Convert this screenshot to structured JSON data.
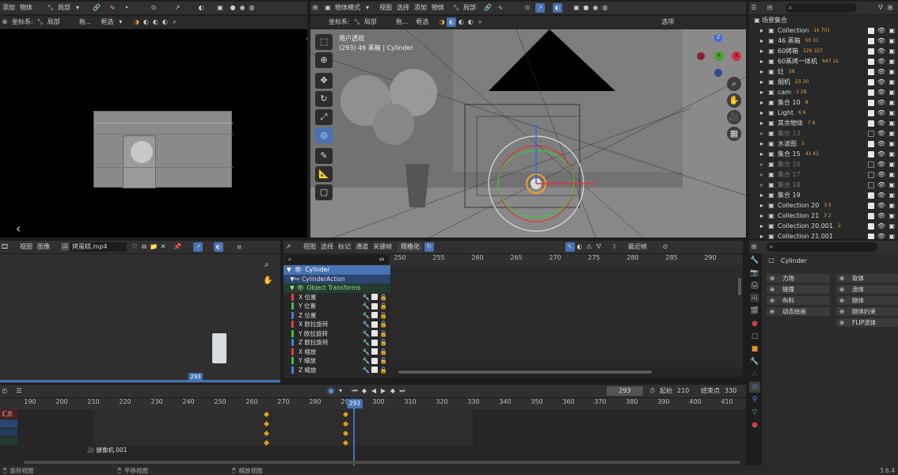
{
  "camview": {
    "menu": [
      "添加",
      "物体"
    ],
    "orient_label": "局部",
    "coord_label": "坐标系:",
    "coord_value": "局部",
    "drag_label": "拖...",
    "select_label": "框选"
  },
  "viewport": {
    "mode": "物体模式",
    "menu": [
      "视图",
      "选择",
      "添加",
      "物体"
    ],
    "orient_label": "局部",
    "coord_label": "坐标系:",
    "coord_value": "局部",
    "drag_label": "拖...",
    "select_label": "框选",
    "options_label": "选项",
    "overlay_title": "用户透视",
    "overlay_sub": "(293) 46 蒸箱 | Cylinder",
    "gizmo_labels": [
      "Z",
      "Y",
      "X"
    ]
  },
  "outliner": {
    "search_placeholder": "",
    "root": "场景集合",
    "items": [
      {
        "name": "Collection",
        "badge": "1k 701",
        "enabled": true
      },
      {
        "name": "46 蒸箱",
        "badge": "50 31",
        "enabled": true
      },
      {
        "name": "60烤箱",
        "badge": "226 327",
        "enabled": true
      },
      {
        "name": "60蒸烤一体机",
        "badge": "647 1k",
        "enabled": true
      },
      {
        "name": "灶",
        "badge": "58",
        "enabled": true
      },
      {
        "name": "烟机",
        "badge": "23 20",
        "enabled": true
      },
      {
        "name": "cam",
        "badge": "3 28",
        "enabled": true
      },
      {
        "name": "集合 10",
        "badge": "8",
        "enabled": true
      },
      {
        "name": "Light",
        "badge": "6 6",
        "enabled": true
      },
      {
        "name": "其余物体",
        "badge": "7 6",
        "enabled": true
      },
      {
        "name": "集合 13",
        "badge": "",
        "enabled": false
      },
      {
        "name": "水波图",
        "badge": "2",
        "enabled": true
      },
      {
        "name": "集合 15",
        "badge": "43 41",
        "enabled": true
      },
      {
        "name": "集合 16",
        "badge": "",
        "enabled": false
      },
      {
        "name": "集合 17",
        "badge": "",
        "enabled": false
      },
      {
        "name": "集合 18",
        "badge": "",
        "enabled": false
      },
      {
        "name": "集合 19",
        "badge": "",
        "enabled": true
      },
      {
        "name": "Collection 20",
        "badge": "3 5",
        "enabled": true
      },
      {
        "name": "Collection 21",
        "badge": "3 2",
        "enabled": true
      },
      {
        "name": "Collection 20.001",
        "badge": "2",
        "enabled": true
      },
      {
        "name": "Collection 21.001",
        "badge": "",
        "enabled": true
      }
    ]
  },
  "video": {
    "menu": [
      "视图",
      "图像"
    ],
    "filename": "烤蛋糕.mp4",
    "frame_badge": "293"
  },
  "graph": {
    "menu": [
      "视图",
      "选择",
      "标记",
      "通道",
      "关键帧"
    ],
    "normalize_label": "规格化",
    "snap_label": "最近帧",
    "ticks": [
      "250",
      "255",
      "260",
      "265",
      "270",
      "275",
      "280",
      "285",
      "290"
    ],
    "channels_header": "Cylinder",
    "action": "CylinderAction",
    "group": "Object Transforms",
    "channels": [
      {
        "label": "X 位置",
        "color": "#e04040"
      },
      {
        "label": "Y 位置",
        "color": "#40c040"
      },
      {
        "label": "Z 位置",
        "color": "#4080e0"
      },
      {
        "label": "X 欧拉旋转",
        "color": "#e04040"
      },
      {
        "label": "Y 欧拉旋转",
        "color": "#40c040"
      },
      {
        "label": "Z 欧拉旋转",
        "color": "#4080e0"
      },
      {
        "label": "X 缩放",
        "color": "#e04040"
      },
      {
        "label": "Y 缩放",
        "color": "#40c040"
      },
      {
        "label": "Z 缩放",
        "color": "#4080e0"
      }
    ]
  },
  "properties": {
    "object_name": "Cylinder",
    "buttons": [
      [
        "力场",
        "软体"
      ],
      [
        "碰撞",
        "流体"
      ],
      [
        "布料",
        "刚体"
      ],
      [
        "动态绘画",
        "刚体约束"
      ],
      [
        "",
        "FLIP流体"
      ]
    ]
  },
  "timeline": {
    "current_frame": "293",
    "start_label": "起始",
    "start": "210",
    "end_label": "结束点",
    "end": "330",
    "ticks": [
      "190",
      "200",
      "210",
      "220",
      "230",
      "240",
      "250",
      "260",
      "270",
      "280",
      "290",
      "300",
      "310",
      "320",
      "330",
      "340",
      "350",
      "360",
      "370",
      "380",
      "390",
      "400",
      "410"
    ],
    "summary_label": "汇总",
    "camera_marker": "摄像机.001"
  },
  "status": {
    "items": [
      "旋转视图",
      "平移视图",
      "缩放视图"
    ],
    "version": "3.6.4"
  }
}
